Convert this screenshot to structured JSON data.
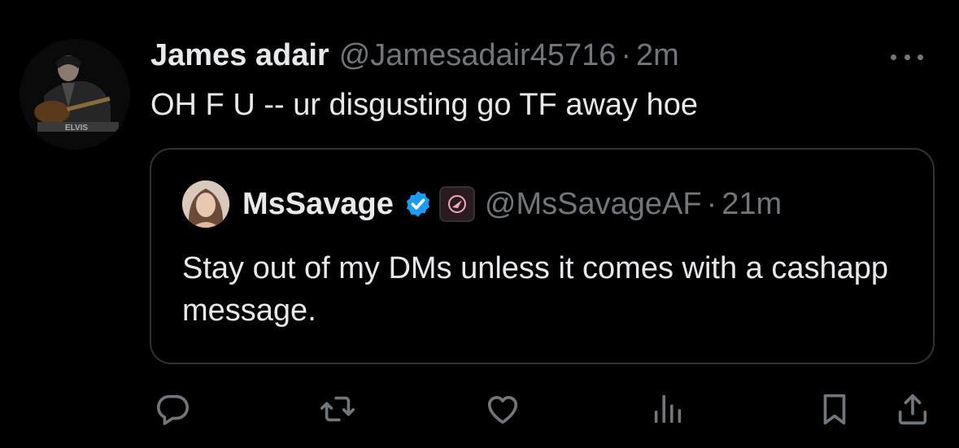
{
  "tweet": {
    "author_name": "James adair",
    "author_handle": "@Jamesadair45716",
    "separator": "·",
    "time": "2m",
    "text": "OH F U -- ur disgusting go TF away hoe"
  },
  "quoted_tweet": {
    "author_name": "MsSavage",
    "author_handle": "@MsSavageAF",
    "separator": "·",
    "time": "21m",
    "text": "Stay out of my DMs unless it comes with a cashapp message.",
    "verified": true
  },
  "actions": {
    "icons": [
      "reply-icon",
      "repost-icon",
      "like-icon",
      "views-icon",
      "bookmark-icon",
      "share-icon"
    ]
  },
  "colors": {
    "background": "#000000",
    "text_primary": "#e7e9ea",
    "text_secondary": "#71767b",
    "border": "#2f3336",
    "verified_blue": "#1d9bf0"
  }
}
